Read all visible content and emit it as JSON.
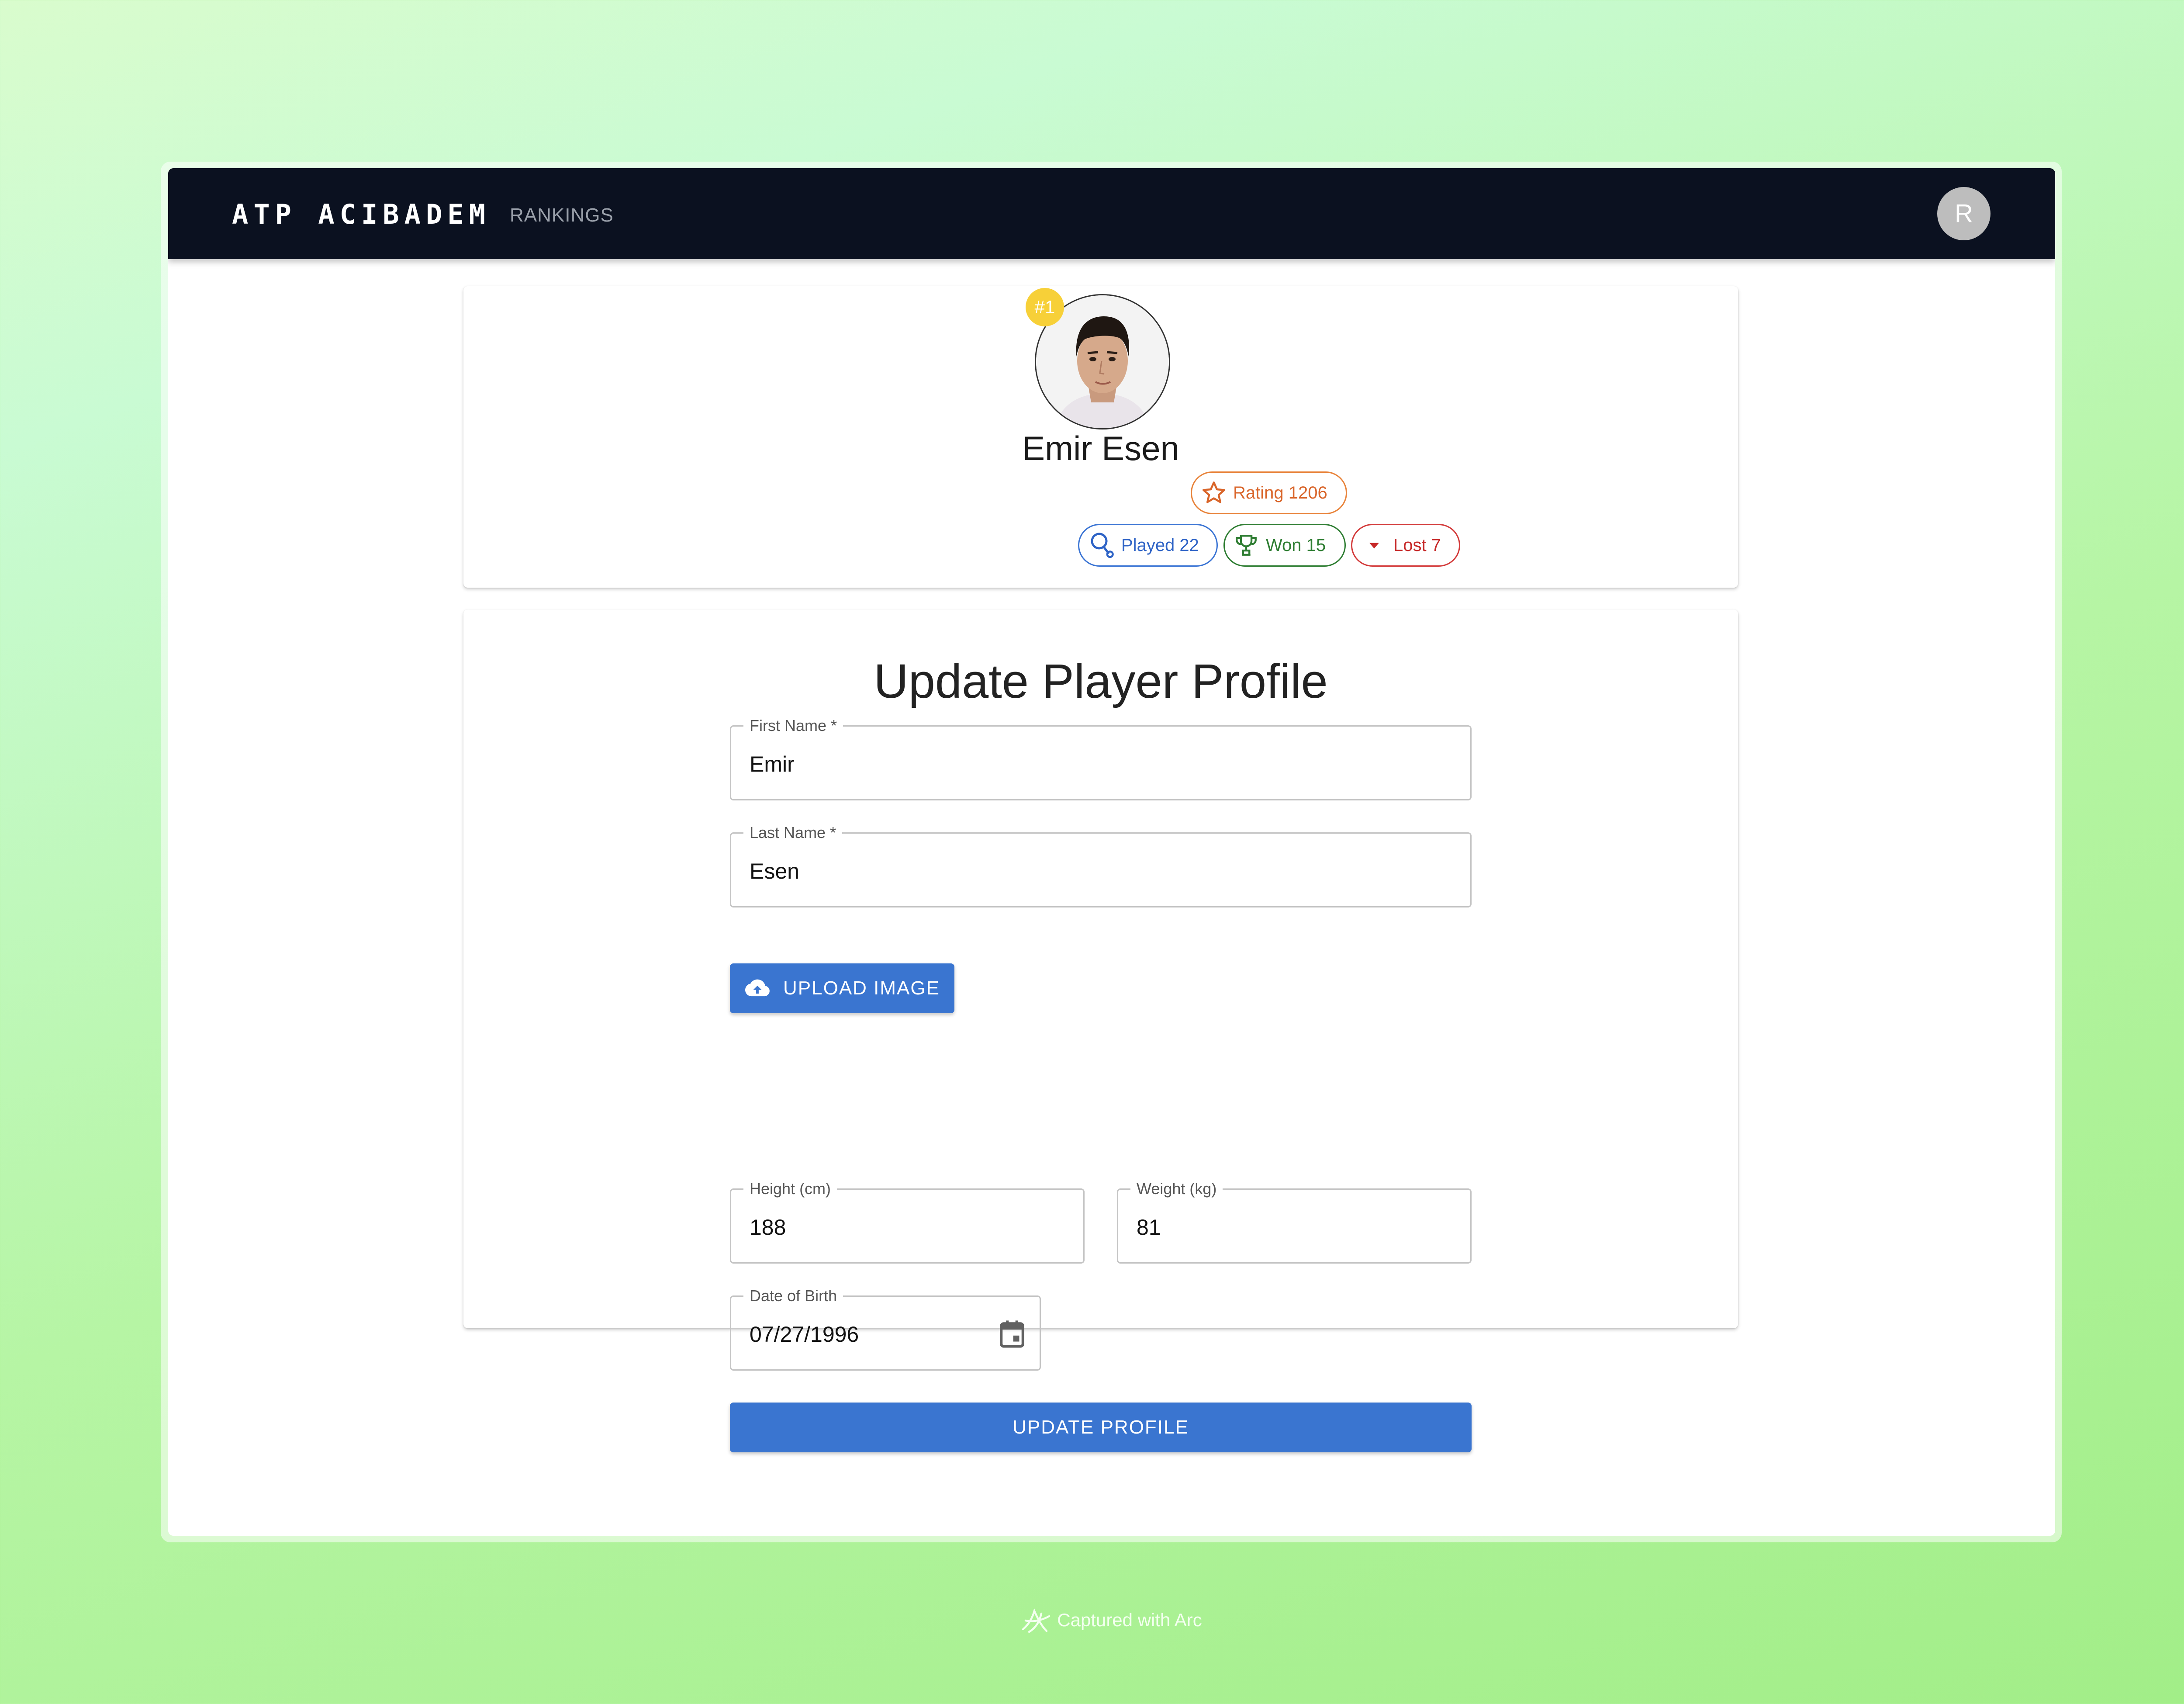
{
  "app": {
    "brand": "ATP ACIBADEM",
    "nav": {
      "rankings": "RANKINGS"
    },
    "user_avatar_initial": "R"
  },
  "profile": {
    "rank_badge": "#1",
    "name": "Emir Esen",
    "rating": "Rating 1206",
    "played": "Played 22",
    "won": "Won 15",
    "lost": "Lost 7"
  },
  "form": {
    "title": "Update Player Profile",
    "first_name": {
      "label": "First Name *",
      "value": "Emir"
    },
    "last_name": {
      "label": "Last Name *",
      "value": "Esen"
    },
    "upload_button": "UPLOAD IMAGE",
    "height": {
      "label": "Height (cm)",
      "value": "188"
    },
    "weight": {
      "label": "Weight (kg)",
      "value": "81"
    },
    "dob": {
      "label": "Date of Birth",
      "value": "07/27/1996"
    },
    "submit_button": "UPDATE PROFILE"
  },
  "footer": {
    "text": "Captured with Arc"
  },
  "colors": {
    "appbar": "#0b1120",
    "primary": "#3a75d0",
    "rating": "#d9652a",
    "played": "#2e63c6",
    "won": "#2e7d32",
    "lost": "#c62828",
    "rank_badge": "#f7d038"
  }
}
